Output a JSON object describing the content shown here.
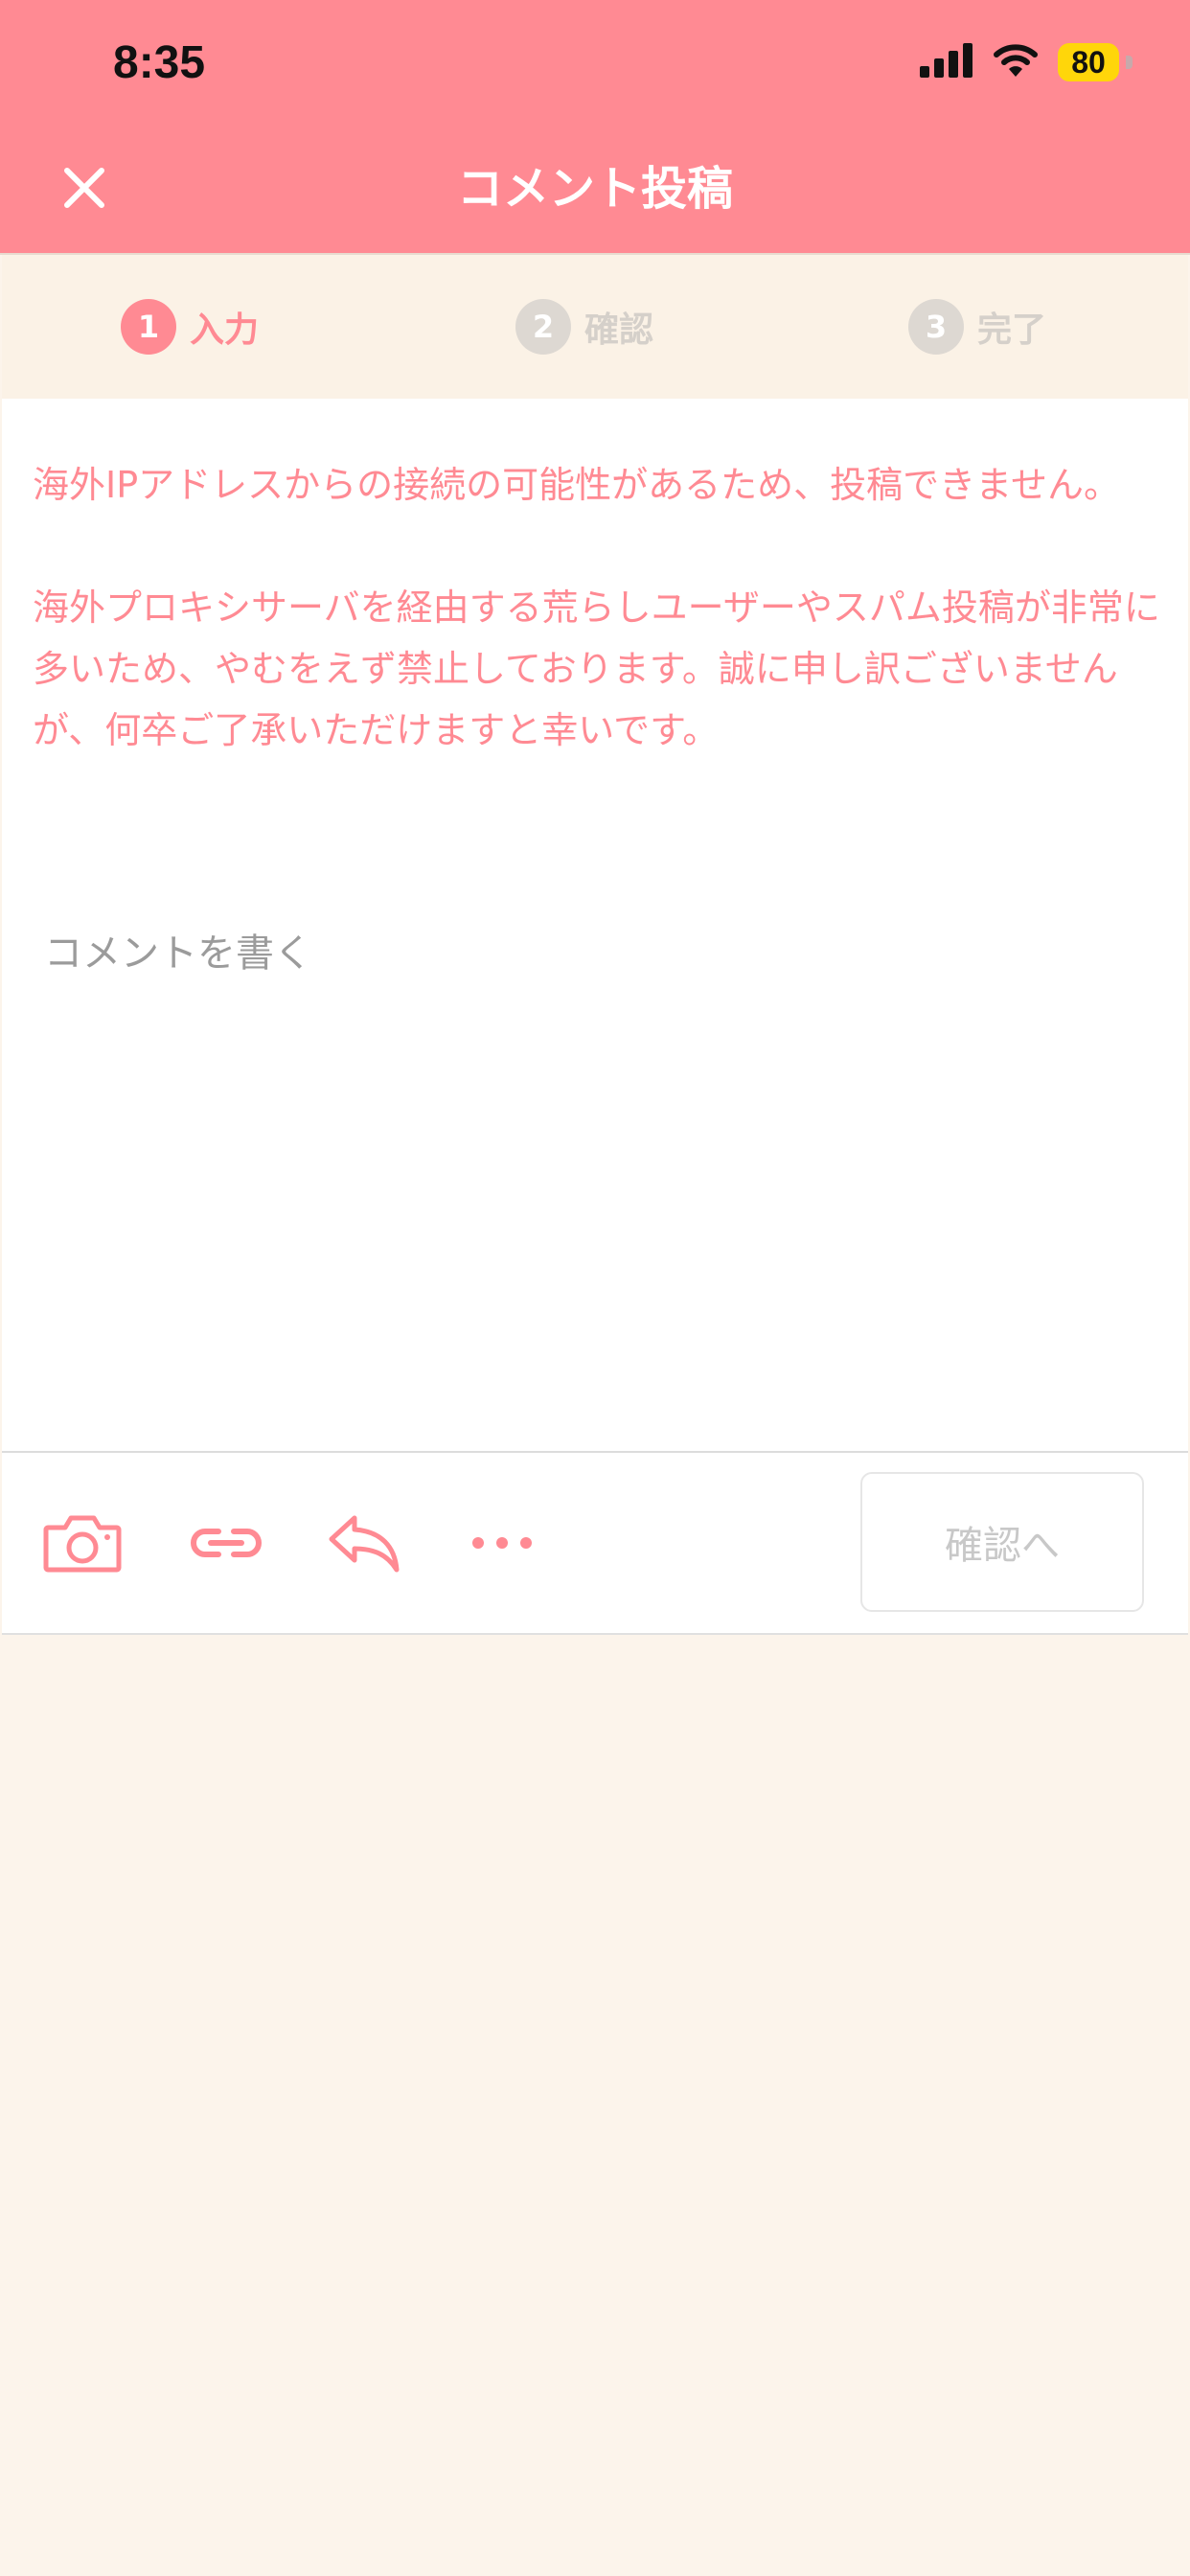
{
  "status_bar": {
    "time": "8:35",
    "battery": "80"
  },
  "header": {
    "title": "コメント投稿"
  },
  "steps": [
    {
      "number": "1",
      "label": "入力",
      "state": "active"
    },
    {
      "number": "2",
      "label": "確認",
      "state": "inactive"
    },
    {
      "number": "3",
      "label": "完了",
      "state": "inactive"
    }
  ],
  "notice": {
    "paragraph1": "海外IPアドレスからの接続の可能性があるため、投稿できません。",
    "paragraph2": "海外プロキシサーバを経由する荒らしユーザーやスパム投稿が非常に多いため、やむをえず禁止しております。誠に申し訳ございませんが、何卒ご了承いただけますと幸いです。"
  },
  "comment": {
    "placeholder": "コメントを書く",
    "value": ""
  },
  "toolbar": {
    "icons": [
      "camera-icon",
      "link-icon",
      "reply-icon",
      "more-icon"
    ],
    "confirm_label": "確認へ"
  },
  "colors": {
    "accent": "#ff8a93",
    "background": "#fcf4eb",
    "steps_background": "#fbf2e6",
    "inactive": "#ddd8d2",
    "battery": "#ffd60a"
  }
}
